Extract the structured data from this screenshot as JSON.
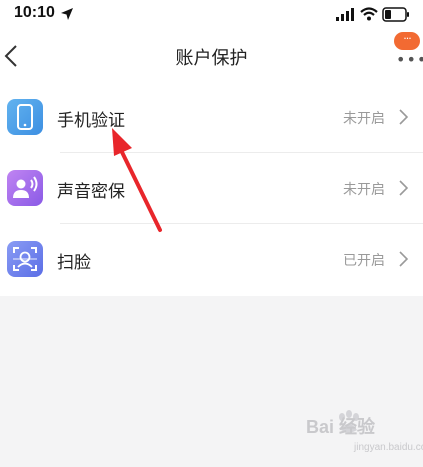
{
  "status_bar": {
    "time": "10:10",
    "icons": [
      "location-arrow-icon",
      "signal-icon",
      "wifi-icon",
      "battery-icon"
    ]
  },
  "nav": {
    "title": "账户保护",
    "back_icon": "chevron-left-icon",
    "more_badge": "···",
    "more_icon": "more-dots-icon"
  },
  "items": [
    {
      "label": "手机验证",
      "status": "未开启",
      "icon": "phone-icon"
    },
    {
      "label": "声音密保",
      "status": "未开启",
      "icon": "voice-icon"
    },
    {
      "label": "扫脸",
      "status": "已开启",
      "icon": "face-scan-icon"
    }
  ],
  "watermark": {
    "text": "Bai 经验",
    "sub": "jingyan.baidu.com"
  },
  "colors": {
    "accent_orange": "#f26a32",
    "annotation_red": "#e8262b",
    "status_gray": "#9a9a9a",
    "background": "#f4f4f5"
  }
}
